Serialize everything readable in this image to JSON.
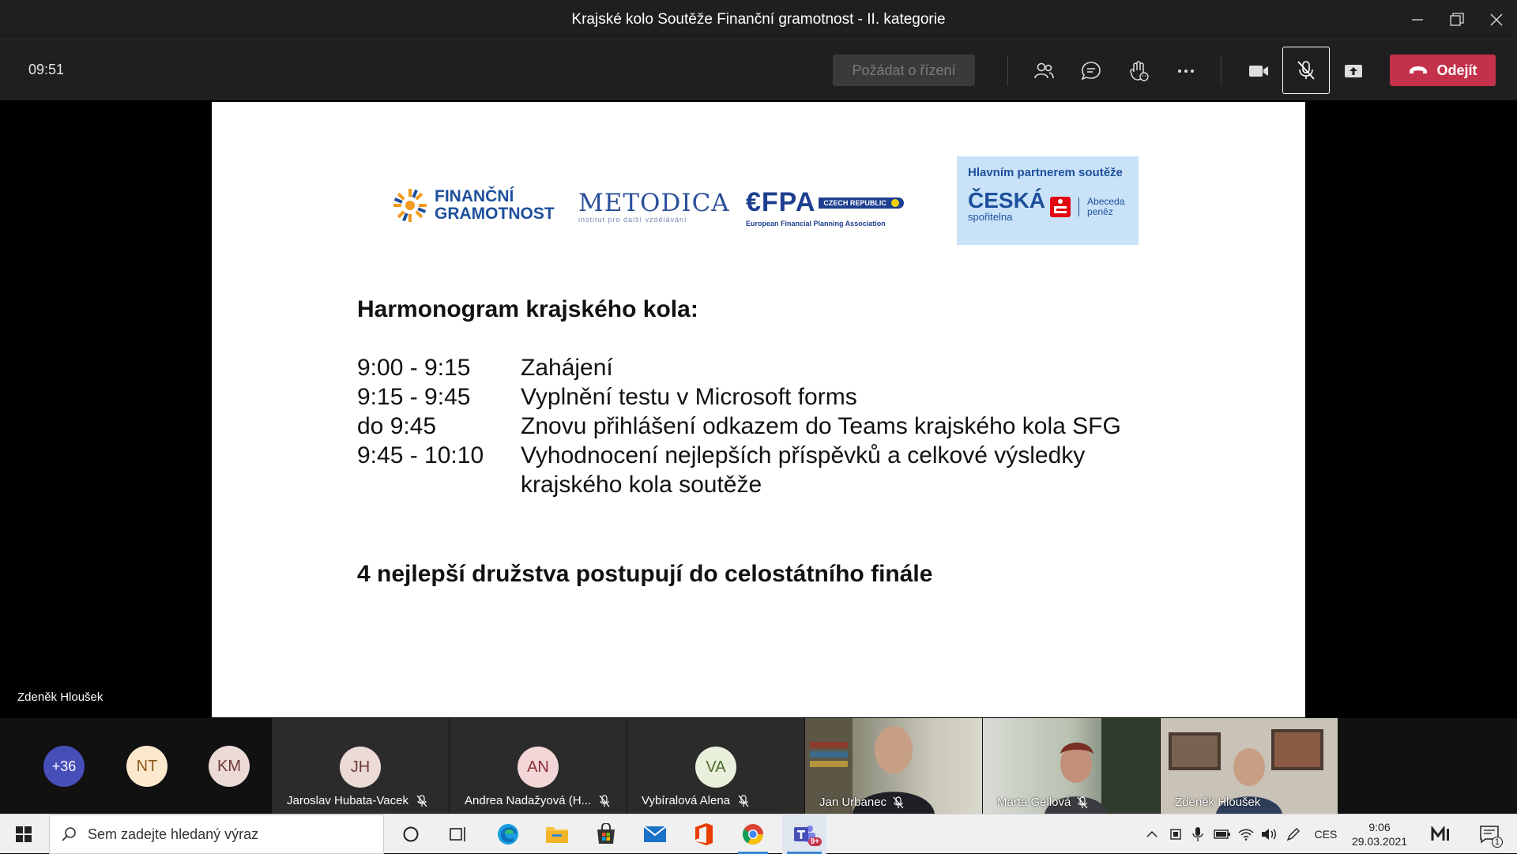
{
  "window": {
    "title": "Krajské kolo Soutěže Finanční gramotnost - II. kategorie"
  },
  "toolbar": {
    "timer": "09:51",
    "request_control_label": "Požádat o řízení",
    "leave_label": "Odejít"
  },
  "stage": {
    "presenter_name": "Zdeněk Hloušek"
  },
  "slide": {
    "logos": {
      "fg_line1": "FINANČNÍ",
      "fg_line2": "GRAMOTNOST",
      "metodica": "METODICA",
      "metodica_sub": "institut pro další vzdělávání",
      "efpa": "€FPA",
      "efpa_badge": "CZECH REPUBLIC",
      "efpa_sub": "European Financial Planning Association",
      "partner_title": "Hlavním partnerem soutěže",
      "partner_name": "ČESKÁ",
      "partner_sub": "spořitelna",
      "partner_tag_line1": "Abeceda",
      "partner_tag_line2": "peněz"
    },
    "heading": "Harmonogram krajského kola:",
    "schedule": [
      {
        "time": "9:00 - 9:15",
        "activity": "Zahájení"
      },
      {
        "time": "9:15 - 9:45",
        "activity": "Vyplnění testu v Microsoft forms"
      },
      {
        "time": "do 9:45",
        "activity": "Znovu přihlášení odkazem do Teams krajského kola SFG"
      },
      {
        "time": "9:45 - 10:10",
        "activity": "Vyhodnocení nejlepších příspěvků a celkové výsledky krajského kola soutěže"
      }
    ],
    "footer": "4 nejlepší družstva postupují do celostátního finále"
  },
  "participants": {
    "overflow_count": "+36",
    "avatars": [
      {
        "initials": "NT",
        "color": "#fbe8cd",
        "text_color": "#8a5a1f"
      },
      {
        "initials": "KM",
        "color": "#ecdad6",
        "text_color": "#6b3b33"
      }
    ],
    "tiles": [
      {
        "initials": "JH",
        "name": "Jaroslav Hubata-Vacek",
        "color": "#ecdad6",
        "text_color": "#6b3b33"
      },
      {
        "initials": "AN",
        "name": "Andrea Nadažyová (H...",
        "color": "#f3d6d8",
        "text_color": "#8a2f37"
      },
      {
        "initials": "VA",
        "name": "Vybíralová Alena",
        "color": "#e8f0dc",
        "text_color": "#4a6a2a"
      }
    ],
    "videos": [
      {
        "name": "Jan Urbanec"
      },
      {
        "name": "Marta Gellová"
      },
      {
        "name": "Zdeněk Hloušek"
      }
    ]
  },
  "taskbar": {
    "search_placeholder": "Sem zadejte hledaný výraz",
    "language": "CES",
    "time": "9:06",
    "date": "29.03.2021",
    "teams_badge": "9+",
    "notification_count": "1"
  },
  "colors": {
    "teams_dark": "#1f1f1f",
    "leave_red": "#c4314b",
    "avatar_overflow": "#464eb8"
  }
}
